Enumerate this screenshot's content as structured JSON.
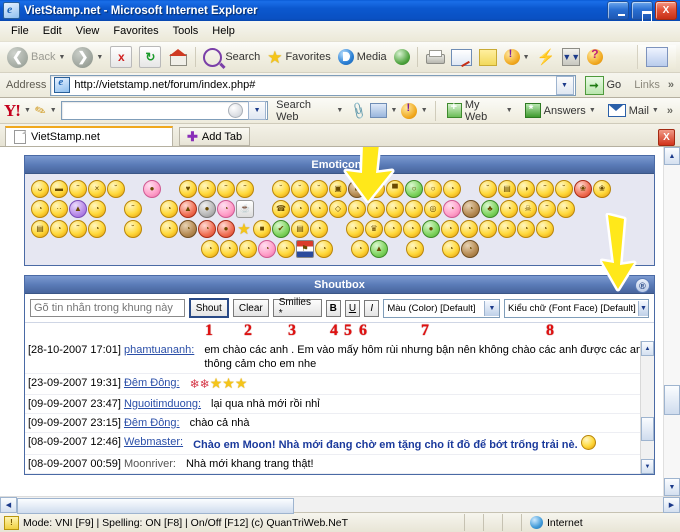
{
  "window": {
    "title": "VietStamp.net - Microsoft Internet Explorer",
    "minimize_label": "_",
    "maximize_label": "",
    "close_label": "X"
  },
  "menu": {
    "items": [
      "File",
      "Edit",
      "View",
      "Favorites",
      "Tools",
      "Help"
    ]
  },
  "toolbar": {
    "back_label": "Back",
    "forward_label": "",
    "stop_label": "x",
    "refresh_label": "↻",
    "home_label": "",
    "search_label": "Search",
    "favorites_label": "Favorites",
    "media_label": "Media",
    "history_label": "",
    "print_label": "",
    "edit_label": "",
    "note_label": "",
    "yahoo_label": "",
    "messenger_label": "",
    "download_label": "",
    "dropdown_caret": "▾"
  },
  "address": {
    "label": "Address",
    "url": "http://vietstamp.net/forum/index.php#",
    "go_label": "Go",
    "links_label": "Links",
    "overflow_label": "»"
  },
  "yahoo_bar": {
    "logo": "Y!",
    "search_value": "",
    "search_placeholder": "",
    "search_web_label": "Search Web",
    "my_web_label": "My Web",
    "answers_label": "Answers",
    "mail_label": "Mail",
    "overflow_label": "»"
  },
  "tabs": {
    "items": [
      {
        "label": "VietStamp.net"
      }
    ],
    "add_tab_label": "Add Tab",
    "close_label": "X"
  },
  "emoticons_panel": {
    "title": "Emoticons",
    "rows": [
      [
        {
          "g": "ᴗ",
          "c": ""
        },
        {
          "g": "▬",
          "c": ""
        },
        {
          "g": "˜",
          "c": ""
        },
        {
          "g": "×",
          "c": ""
        },
        {
          "g": "˘",
          "c": ""
        },
        {
          "g": "",
          "c": "blank"
        },
        {
          "g": "●",
          "c": "pink"
        },
        {
          "g": "",
          "c": "blank"
        },
        {
          "g": "♥",
          "c": ""
        },
        {
          "g": "◔",
          "c": ""
        },
        {
          "g": "˜",
          "c": ""
        },
        {
          "g": "˜",
          "c": ""
        },
        {
          "g": "",
          "c": "blank"
        },
        {
          "g": "˘",
          "c": ""
        },
        {
          "g": "˘",
          "c": ""
        },
        {
          "g": "˘",
          "c": ""
        },
        {
          "g": "▣",
          "c": ""
        },
        {
          "g": "■",
          "c": "brown"
        },
        {
          "g": "˘",
          "c": ""
        },
        {
          "g": "▀",
          "c": ""
        },
        {
          "g": "○",
          "c": "green"
        },
        {
          "g": "○",
          "c": ""
        },
        {
          "g": "◔",
          "c": ""
        },
        {
          "g": "",
          "c": "blank"
        },
        {
          "g": "˘",
          "c": ""
        },
        {
          "g": "▤",
          "c": ""
        },
        {
          "g": "◑",
          "c": ""
        },
        {
          "g": "˜",
          "c": ""
        },
        {
          "g": "˘",
          "c": ""
        },
        {
          "g": "❀",
          "c": "red"
        },
        {
          "g": "❀",
          "c": ""
        }
      ],
      [
        {
          "g": "◔",
          "c": ""
        },
        {
          "g": "··",
          "c": ""
        },
        {
          "g": "▲",
          "c": "purple"
        },
        {
          "g": "◔",
          "c": ""
        },
        {
          "g": "",
          "c": "blank"
        },
        {
          "g": "˜",
          "c": ""
        },
        {
          "g": "",
          "c": "blank"
        },
        {
          "g": "◔",
          "c": ""
        },
        {
          "g": "▲",
          "c": "red"
        },
        {
          "g": "●",
          "c": "grey"
        },
        {
          "g": "◔",
          "c": "pink"
        },
        {
          "g": "☕",
          "c": "cup"
        },
        {
          "g": "",
          "c": "blank"
        },
        {
          "g": "☎",
          "c": ""
        },
        {
          "g": "◔",
          "c": ""
        },
        {
          "g": "◔",
          "c": ""
        },
        {
          "g": "◇",
          "c": ""
        },
        {
          "g": "◔",
          "c": ""
        },
        {
          "g": "◔",
          "c": ""
        },
        {
          "g": "◔",
          "c": ""
        },
        {
          "g": "◔",
          "c": ""
        },
        {
          "g": "◎",
          "c": ""
        },
        {
          "g": "◔",
          "c": "pink"
        },
        {
          "g": "◔",
          "c": "brown"
        },
        {
          "g": "♣",
          "c": "green"
        },
        {
          "g": "◔",
          "c": ""
        },
        {
          "g": "☠",
          "c": ""
        },
        {
          "g": "˜",
          "c": ""
        },
        {
          "g": "◔",
          "c": ""
        }
      ],
      [
        {
          "g": "▤",
          "c": ""
        },
        {
          "g": "◔",
          "c": ""
        },
        {
          "g": "˜",
          "c": ""
        },
        {
          "g": "◔",
          "c": ""
        },
        {
          "g": "",
          "c": "blank"
        },
        {
          "g": "˘",
          "c": ""
        },
        {
          "g": "",
          "c": "blank"
        },
        {
          "g": "◔",
          "c": ""
        },
        {
          "g": "◔",
          "c": "brown"
        },
        {
          "g": "◔",
          "c": "red"
        },
        {
          "g": "●",
          "c": "red"
        },
        {
          "g": "★",
          "c": "star"
        },
        {
          "g": "■",
          "c": ""
        },
        {
          "g": "✔",
          "c": "green"
        },
        {
          "g": "▤",
          "c": ""
        },
        {
          "g": "◔",
          "c": ""
        },
        {
          "g": "",
          "c": "blank"
        },
        {
          "g": "◔",
          "c": ""
        },
        {
          "g": "♛",
          "c": ""
        },
        {
          "g": "◔",
          "c": ""
        },
        {
          "g": "◔",
          "c": ""
        },
        {
          "g": "●",
          "c": "green"
        },
        {
          "g": "◔",
          "c": ""
        },
        {
          "g": "◔",
          "c": ""
        },
        {
          "g": "◔",
          "c": ""
        },
        {
          "g": "◔",
          "c": ""
        },
        {
          "g": "◔",
          "c": ""
        },
        {
          "g": "◔",
          "c": ""
        }
      ],
      [
        {
          "g": "",
          "c": "blank"
        },
        {
          "g": "",
          "c": "blank"
        },
        {
          "g": "",
          "c": "blank"
        },
        {
          "g": "",
          "c": "blank"
        },
        {
          "g": "",
          "c": "blank"
        },
        {
          "g": "",
          "c": "blank"
        },
        {
          "g": "",
          "c": "blank"
        },
        {
          "g": "",
          "c": "blank"
        },
        {
          "g": "",
          "c": "blank"
        },
        {
          "g": "",
          "c": "blank"
        },
        {
          "g": "◔",
          "c": ""
        },
        {
          "g": "◔",
          "c": ""
        },
        {
          "g": "◔",
          "c": ""
        },
        {
          "g": "◔",
          "c": "pink"
        },
        {
          "g": "◔",
          "c": ""
        },
        {
          "g": "⚑",
          "c": "flag"
        },
        {
          "g": "◔",
          "c": ""
        },
        {
          "g": "",
          "c": "blank"
        },
        {
          "g": "◔",
          "c": ""
        },
        {
          "g": "▲",
          "c": "green"
        },
        {
          "g": "",
          "c": "blank"
        },
        {
          "g": "◔",
          "c": ""
        },
        {
          "g": "",
          "c": "blank"
        },
        {
          "g": "◔",
          "c": ""
        },
        {
          "g": "◔",
          "c": "brown"
        }
      ]
    ]
  },
  "shoutbox": {
    "title": "Shoutbox",
    "collapse_icon": "®",
    "input_placeholder": "Gõ tin nhắn trong khung này",
    "input_value": "",
    "shout_label": "Shout",
    "clear_label": "Clear",
    "smilies_label": "Smilies *",
    "bold_label": "B",
    "underline_label": "U",
    "italic_label": "I",
    "color_select_label": "Màu (Color) [Default]",
    "font_select_label": "Kiểu chữ (Font Face) [Default]",
    "annotation_numbers": [
      "1",
      "2",
      "3",
      "4",
      "5",
      "6",
      "7",
      "8"
    ],
    "messages": [
      {
        "timestamp": "[28-10-2007 17:01]",
        "user": "phamtuananh",
        "user_linked": true,
        "colon": ":",
        "text": "em chào các anh . Em vào mấy hôm rùi nhưng bận nên không chào các anh được các anh thông cảm cho em nhe",
        "bold": false
      },
      {
        "timestamp": "[23-09-2007 19:31]",
        "user": "Đêm Đông",
        "user_linked": true,
        "colon": ":",
        "text": "",
        "decorations": "roses-stars",
        "bold": false
      },
      {
        "timestamp": "[09-09-2007 23:47]",
        "user": "Nguoitimduong",
        "user_linked": true,
        "colon": ":",
        "text": "lại qua nhà mới rồi nhỉ",
        "bold": false
      },
      {
        "timestamp": "[09-09-2007 23:15]",
        "user": "Đêm Đông",
        "user_linked": true,
        "colon": ":",
        "text": "chào cả nhà",
        "bold": false
      },
      {
        "timestamp": "[08-09-2007 12:46]",
        "user": "Webmaster",
        "user_linked": true,
        "colon": ":",
        "text": "Chào em Moon! Nhà mới đang chờ em tặng cho ít đồ để bớt trống trải nè.",
        "bold": true,
        "trailing_emoticon": true
      },
      {
        "timestamp": "[08-09-2007 00:59]",
        "user": "Moonriver",
        "user_linked": false,
        "colon": ":",
        "text": "Nhà mới khang trang thật!",
        "bold": false
      }
    ]
  },
  "status_bar": {
    "text": "Mode: VNI [F9] | Spelling: ON [F8] | On/Off [F12] (c) QuanTriWeb.NeT",
    "zone_label": "Internet"
  },
  "colors": {
    "accent": "#2a4a86",
    "annotation": "#e01010",
    "arrow": "#ffe81a",
    "panel_header": "#5b7cb8",
    "link": "#2b4fa8",
    "bold_message": "#1b3a9c"
  }
}
